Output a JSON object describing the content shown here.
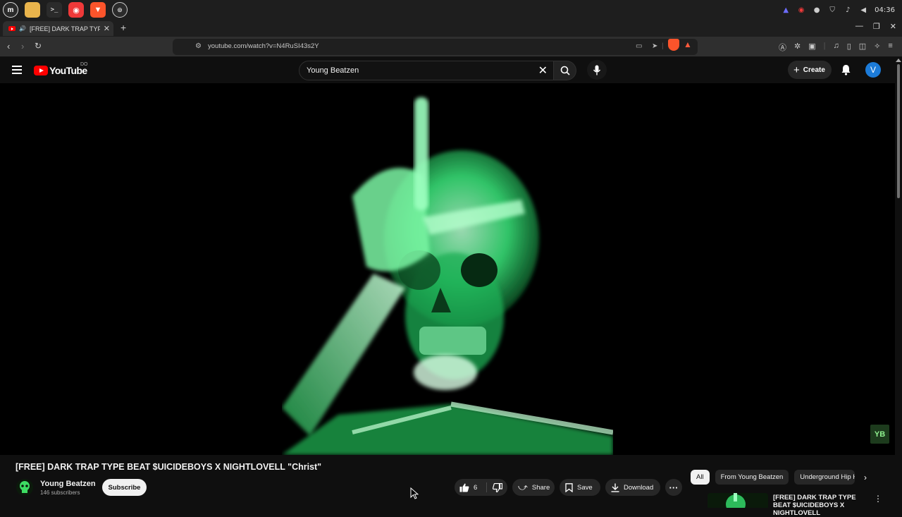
{
  "os": {
    "clock": "04:36",
    "apps": [
      "mint-menu-icon",
      "files-icon",
      "terminal-icon",
      "vivaldi-icon",
      "brave-icon",
      "browser-icon"
    ]
  },
  "browser": {
    "tab_title": "[FREE] DARK TRAP TYPE BEAT $UICIDEBOYS X NIGHTLOVELL \"Christ\"",
    "tab_title_visible": "[FREE] DARK TRAP TYPE B",
    "new_tab": "+",
    "url": "youtube.com/watch?v=N4RuSI43s2Y",
    "brave_reward_count": "1"
  },
  "youtube": {
    "logo_text": "YouTube",
    "logo_sup": "DO",
    "search_value": "Young Beatzen",
    "create_label": "Create",
    "avatar_letter": "V"
  },
  "video": {
    "title": "[FREE] DARK TRAP TYPE BEAT $UICIDEBOYS X NIGHTLOVELL \"Christ\"",
    "watermark": "YB",
    "channel_name": "Young Beatzen",
    "subscribers": "146 subscribers",
    "subscribe_label": "Subscribe",
    "likes": "6",
    "share_label": "Share",
    "save_label": "Save",
    "download_label": "Download"
  },
  "sidebar": {
    "chips": [
      "All",
      "From Young Beatzen",
      "Underground Hip Hop"
    ],
    "rec_title": "[FREE] DARK TRAP TYPE BEAT $UICIDEBOYS X NIGHTLOVELL"
  },
  "colors": {
    "yt_red": "#ff0000",
    "bg": "#0f0f0f",
    "xray_green": "#3cff8a",
    "avatar_blue": "#1c7bd8"
  }
}
